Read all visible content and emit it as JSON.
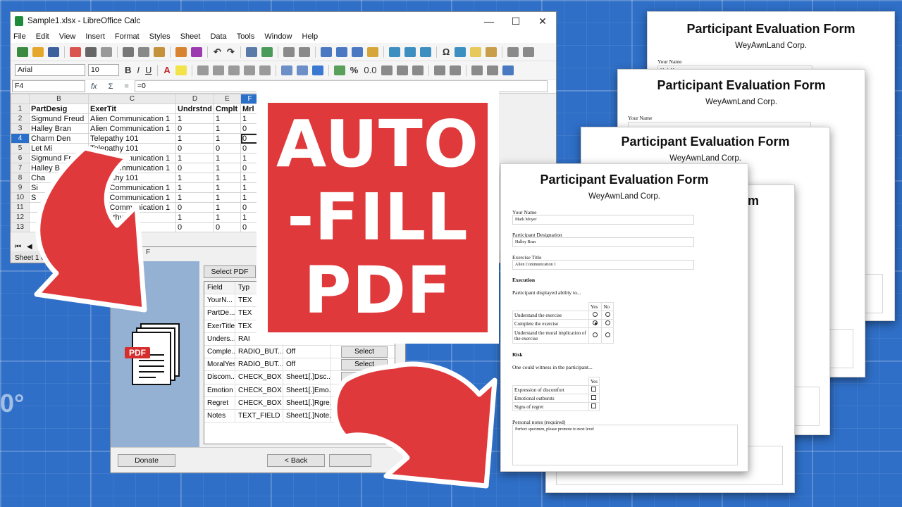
{
  "calc": {
    "title": "Sample1.xlsx - LibreOffice Calc",
    "menu": [
      "File",
      "Edit",
      "View",
      "Insert",
      "Format",
      "Styles",
      "Sheet",
      "Data",
      "Tools",
      "Window",
      "Help"
    ],
    "font_name": "Arial",
    "font_size": "10",
    "cell_ref": "F4",
    "formula": "=0",
    "columns": [
      "B",
      "C",
      "D",
      "E",
      "F"
    ],
    "rows": [
      {
        "n": "1",
        "cells": [
          "PartDesig",
          "ExerTit",
          "Undrstnd",
          "Cmplt",
          "Mrl"
        ]
      },
      {
        "n": "2",
        "cells": [
          "Sigmund Freud",
          "Alien Communication 1",
          "1",
          "1",
          "1"
        ]
      },
      {
        "n": "3",
        "cells": [
          "Halley Bran",
          "Alien Communication 1",
          "0",
          "1",
          "0"
        ]
      },
      {
        "n": "4",
        "cells": [
          "Charm Den",
          "Telepathy 101",
          "1",
          "1",
          "0"
        ]
      },
      {
        "n": "5",
        "cells": [
          "Let Mi",
          "Telepathy 101",
          "0",
          "0",
          "0"
        ]
      },
      {
        "n": "6",
        "cells": [
          "Sigmund Freud",
          "Alien Communication 1",
          "1",
          "1",
          "1"
        ]
      },
      {
        "n": "7",
        "cells": [
          "Halley B",
          "Alien Communication 1",
          "0",
          "1",
          "0"
        ]
      },
      {
        "n": "8",
        "cells": [
          "Cha",
          "Telepathy 101",
          "1",
          "1",
          "1"
        ]
      },
      {
        "n": "9",
        "cells": [
          "Si",
          "Alien Communication 1",
          "1",
          "1",
          "1"
        ]
      },
      {
        "n": "10",
        "cells": [
          "S",
          "Alien Communication 1",
          "1",
          "1",
          "1"
        ]
      },
      {
        "n": "11",
        "cells": [
          "",
          "Alien Communication 1",
          "0",
          "1",
          "0"
        ]
      },
      {
        "n": "12",
        "cells": [
          "",
          "Telepathy 1",
          "1",
          "1",
          "1"
        ]
      },
      {
        "n": "13",
        "cells": [
          "",
          "Telepathy",
          "0",
          "0",
          "0"
        ]
      }
    ],
    "peek_cells": [
      "gmund Freu",
      "lley Bran",
      "gmund Freu"
    ],
    "sheet_status": "Sheet 1 of"
  },
  "dialog": {
    "title_fragment": "F",
    "select_pdf": "Select PDF",
    "headers": [
      "Field",
      "Typ"
    ],
    "fields": [
      {
        "name": "YourN...",
        "type": "TEX",
        "value": "",
        "action": ""
      },
      {
        "name": "PartDe...",
        "type": "TEX",
        "value": "",
        "action": ""
      },
      {
        "name": "ExerTitle",
        "type": "TEX",
        "value": "",
        "action": ""
      },
      {
        "name": "Unders...",
        "type": "RAI",
        "value": "",
        "action": ""
      },
      {
        "name": "Comple...",
        "type": "RADIO_BUT...",
        "value": "Off",
        "action": "Select"
      },
      {
        "name": "MoralYes",
        "type": "RADIO_BUT...",
        "value": "Off",
        "action": "Select"
      },
      {
        "name": "Discom...",
        "type": "CHECK_BOX",
        "value": "Sheet1[.]Dsc...",
        "action": "Select"
      },
      {
        "name": "Emotion",
        "type": "CHECK_BOX",
        "value": "Sheet1[.]Emo...",
        "action": "Select"
      },
      {
        "name": "Regret",
        "type": "CHECK_BOX",
        "value": "Sheet1[.]Rgre...",
        "action": "Select"
      },
      {
        "name": "Notes",
        "type": "TEXT_FIELD",
        "value": "Sheet1[.]Note...",
        "action": "Select"
      }
    ],
    "pdf_icon_text": "PDF",
    "donate": "Donate",
    "back": "< Back"
  },
  "badge": {
    "lines": [
      "AUTO",
      "-FILL",
      "PDF"
    ]
  },
  "colors": {
    "accent_red": "#e0393b",
    "background_blue": "#2f6fc7"
  },
  "ruler_digit": "0°",
  "form": {
    "title": "Participant Evaluation Form",
    "company": "WeyAwnLand Corp.",
    "your_name_label": "Your Name",
    "your_name_value": "Mark Moyer",
    "designation_label": "Participant Designation",
    "designation_value": "Halley Bran",
    "exercise_label": "Exercise Title",
    "exercise_value": "Alien Communication 1",
    "execution_heading": "Execution",
    "execution_intro": "Participant displayed ability to...",
    "yes": "Yes",
    "no": "No",
    "execution_rows": [
      "Understand the exercise",
      "Complete the exercise",
      "Understand the moral implication of the exercise"
    ],
    "risk_heading": "Risk",
    "risk_intro": "One could witness in the participant...",
    "risk_rows": [
      "Expression of discomfort",
      "Emotional outbursts",
      "Signs of regret"
    ],
    "notes_label": "Personal notes (required)",
    "notes_value": "Perfect specimen, please promote to next level",
    "peek_title_end": "m"
  }
}
